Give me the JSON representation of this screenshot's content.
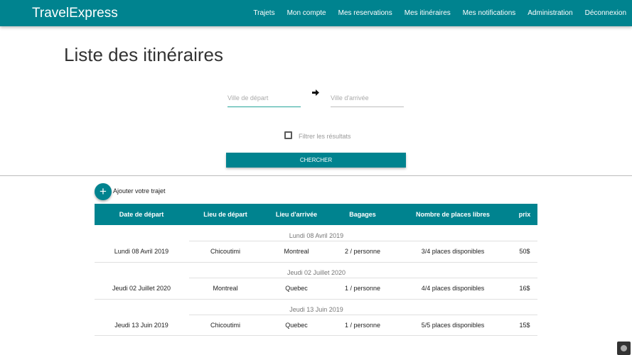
{
  "app": {
    "brand": "TravelExpress",
    "nav": [
      "Trajets",
      "Mon compte",
      "Mes reservations",
      "Mes itinéraires",
      "Mes notifications",
      "Administration",
      "Déconnexion"
    ]
  },
  "page_title": "Liste des itinéraires",
  "search": {
    "departure_placeholder": "Ville de départ",
    "departure_value": "",
    "arrival_placeholder": "Ville d'arrivée",
    "arrival_value": "",
    "filter_label": "Filtrer les résultats",
    "filter_checked": false,
    "button_label": "CHERCHER"
  },
  "add_trip_label": "Ajouter votre trajet",
  "table": {
    "headers": [
      "Date de départ",
      "Lieu de départ",
      "Lieu d'arrivée",
      "Bagages",
      "Nombre de places libres",
      "prix"
    ],
    "groups": [
      {
        "label": "Lundi 08 Avril 2019",
        "row": [
          "Lundi 08 Avril 2019",
          "Chicoutimi",
          "Montreal",
          "2 / personne",
          "3/4 places disponibles",
          "50$"
        ]
      },
      {
        "label": "Jeudi 02 Juillet 2020",
        "row": [
          "Jeudi 02 Juillet 2020",
          "Montreal",
          "Quebec",
          "1 / personne",
          "4/4 places disponibles",
          "16$"
        ]
      },
      {
        "label": "Jeudi 13 Juin 2019",
        "row": [
          "Jeudi 13 Juin 2019",
          "Chicoutimi",
          "Quebec",
          "1 / personne",
          "5/5 places disponibles",
          "15$"
        ]
      }
    ]
  },
  "colors": {
    "primary": "#00838f",
    "focus": "#26a69a"
  }
}
